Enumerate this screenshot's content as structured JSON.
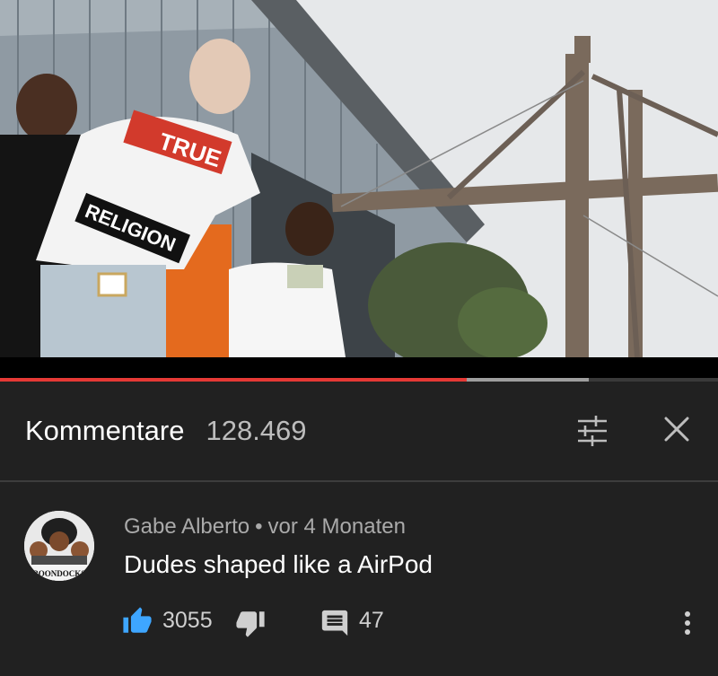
{
  "video": {
    "shirt_text_top": "TRUE",
    "shirt_text_bottom": "RELIGION",
    "progress_fraction": 0.65,
    "buffered_fraction": 0.82
  },
  "comments_panel": {
    "title": "Kommentare",
    "count": "128.469",
    "filter_icon": "sort-filter-icon",
    "close_icon": "close-icon"
  },
  "comment": {
    "author": "Gabe Alberto",
    "separator": "•",
    "time": "vor 4 Monaten",
    "text": "Dudes shaped like a AirPod",
    "avatar_caption": "BOONDOCKS",
    "likes": "3055",
    "replies": "47",
    "like_icon": "thumbs-up-icon",
    "dislike_icon": "thumbs-down-icon",
    "reply_icon": "reply-comment-icon",
    "more_icon": "more-vertical-icon"
  },
  "colors": {
    "background": "#212121",
    "progress": "#e53935",
    "like_active": "#3ea6ff",
    "secondary_text": "#aaaaaa"
  }
}
